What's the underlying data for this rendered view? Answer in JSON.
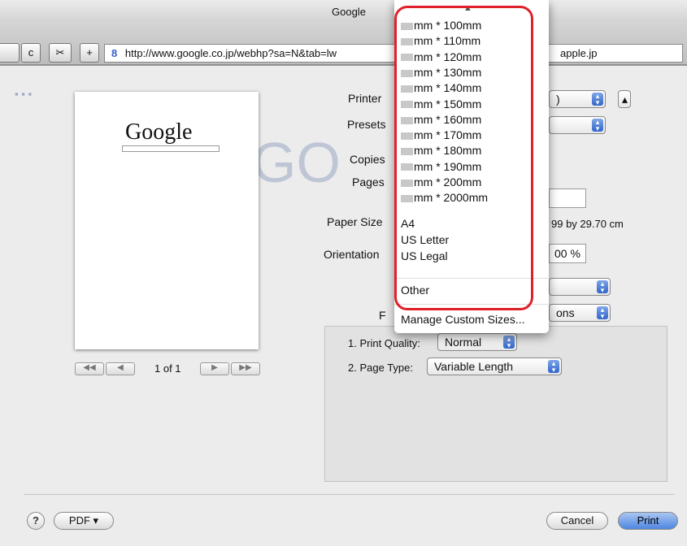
{
  "window": {
    "title": "Google"
  },
  "toolbar": {
    "reload_label": "c",
    "plus_label": "+",
    "url": "http://www.google.co.jp/webhp?sa=N&tab=lw",
    "url_right": "apple.jp"
  },
  "print": {
    "printer_label": "Printer",
    "presets_label": "Presets",
    "copies_label": "Copies",
    "pages_label": "Pages",
    "paper_size_label": "Paper Size",
    "paper_size_value": "99 by 29.70 cm",
    "orientation_label": "Orientation",
    "scale_value": "00 %",
    "f_label": "F",
    "f_popup_value": "ons",
    "print_quality_label": "1. Print Quality:",
    "print_quality_value": "Normal",
    "page_type_label": "2. Page Type:",
    "page_type_value": "Variable Length",
    "page_counter": "1 of 1"
  },
  "menu": {
    "sizes": [
      "mm * 100mm",
      "mm * 110mm",
      "mm * 120mm",
      "mm * 130mm",
      "mm * 140mm",
      "mm * 150mm",
      "mm * 160mm",
      "mm * 170mm",
      "mm * 180mm",
      "mm * 190mm",
      "mm * 200mm",
      "mm * 2000mm"
    ],
    "standard": [
      "A4",
      "US Letter",
      "US Legal"
    ],
    "other": "Other",
    "manage": "Manage Custom Sizes..."
  },
  "bottom": {
    "help": "?",
    "pdf": "PDF ▾",
    "cancel": "Cancel",
    "print": "Print"
  },
  "preview_page": {
    "logo": "Google"
  },
  "colors": {
    "highlight": "#e0202a",
    "accent": "#3165c8"
  }
}
